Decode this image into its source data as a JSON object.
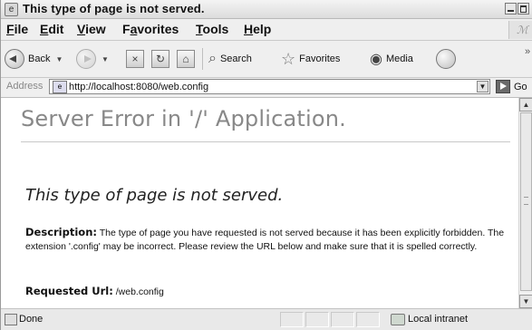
{
  "window": {
    "title": "This type of page is not served."
  },
  "menu": [
    {
      "label": "File",
      "accel": "F",
      "rest": "ile"
    },
    {
      "label": "Edit",
      "accel": "E",
      "rest": "dit"
    },
    {
      "label": "View",
      "accel": "V",
      "rest": "iew"
    },
    {
      "label": "Favorites",
      "accel": "a",
      "pre": "F",
      "rest": "vorites"
    },
    {
      "label": "Tools",
      "accel": "T",
      "rest": "ools"
    },
    {
      "label": "Help",
      "accel": "H",
      "rest": "elp"
    }
  ],
  "toolbar": {
    "back_label": "Back",
    "search_label": "Search",
    "favorites_label": "Favorites",
    "media_label": "Media"
  },
  "address": {
    "label": "Address",
    "url": "http://localhost:8080/web.config",
    "go_label": "Go"
  },
  "page": {
    "heading": "Server Error in '/' Application.",
    "subheading": "This type of page is not served.",
    "description_label": "Description:",
    "description_text": " The type of page you have requested is not served because it has been explicitly forbidden. The extension '.config' may be incorrect. Please review the URL below and make sure that it is spelled correctly.",
    "requested_url_label": "Requested Url:",
    "requested_url_value": " /web.config"
  },
  "status": {
    "text": "Done",
    "zone": "Local intranet"
  }
}
